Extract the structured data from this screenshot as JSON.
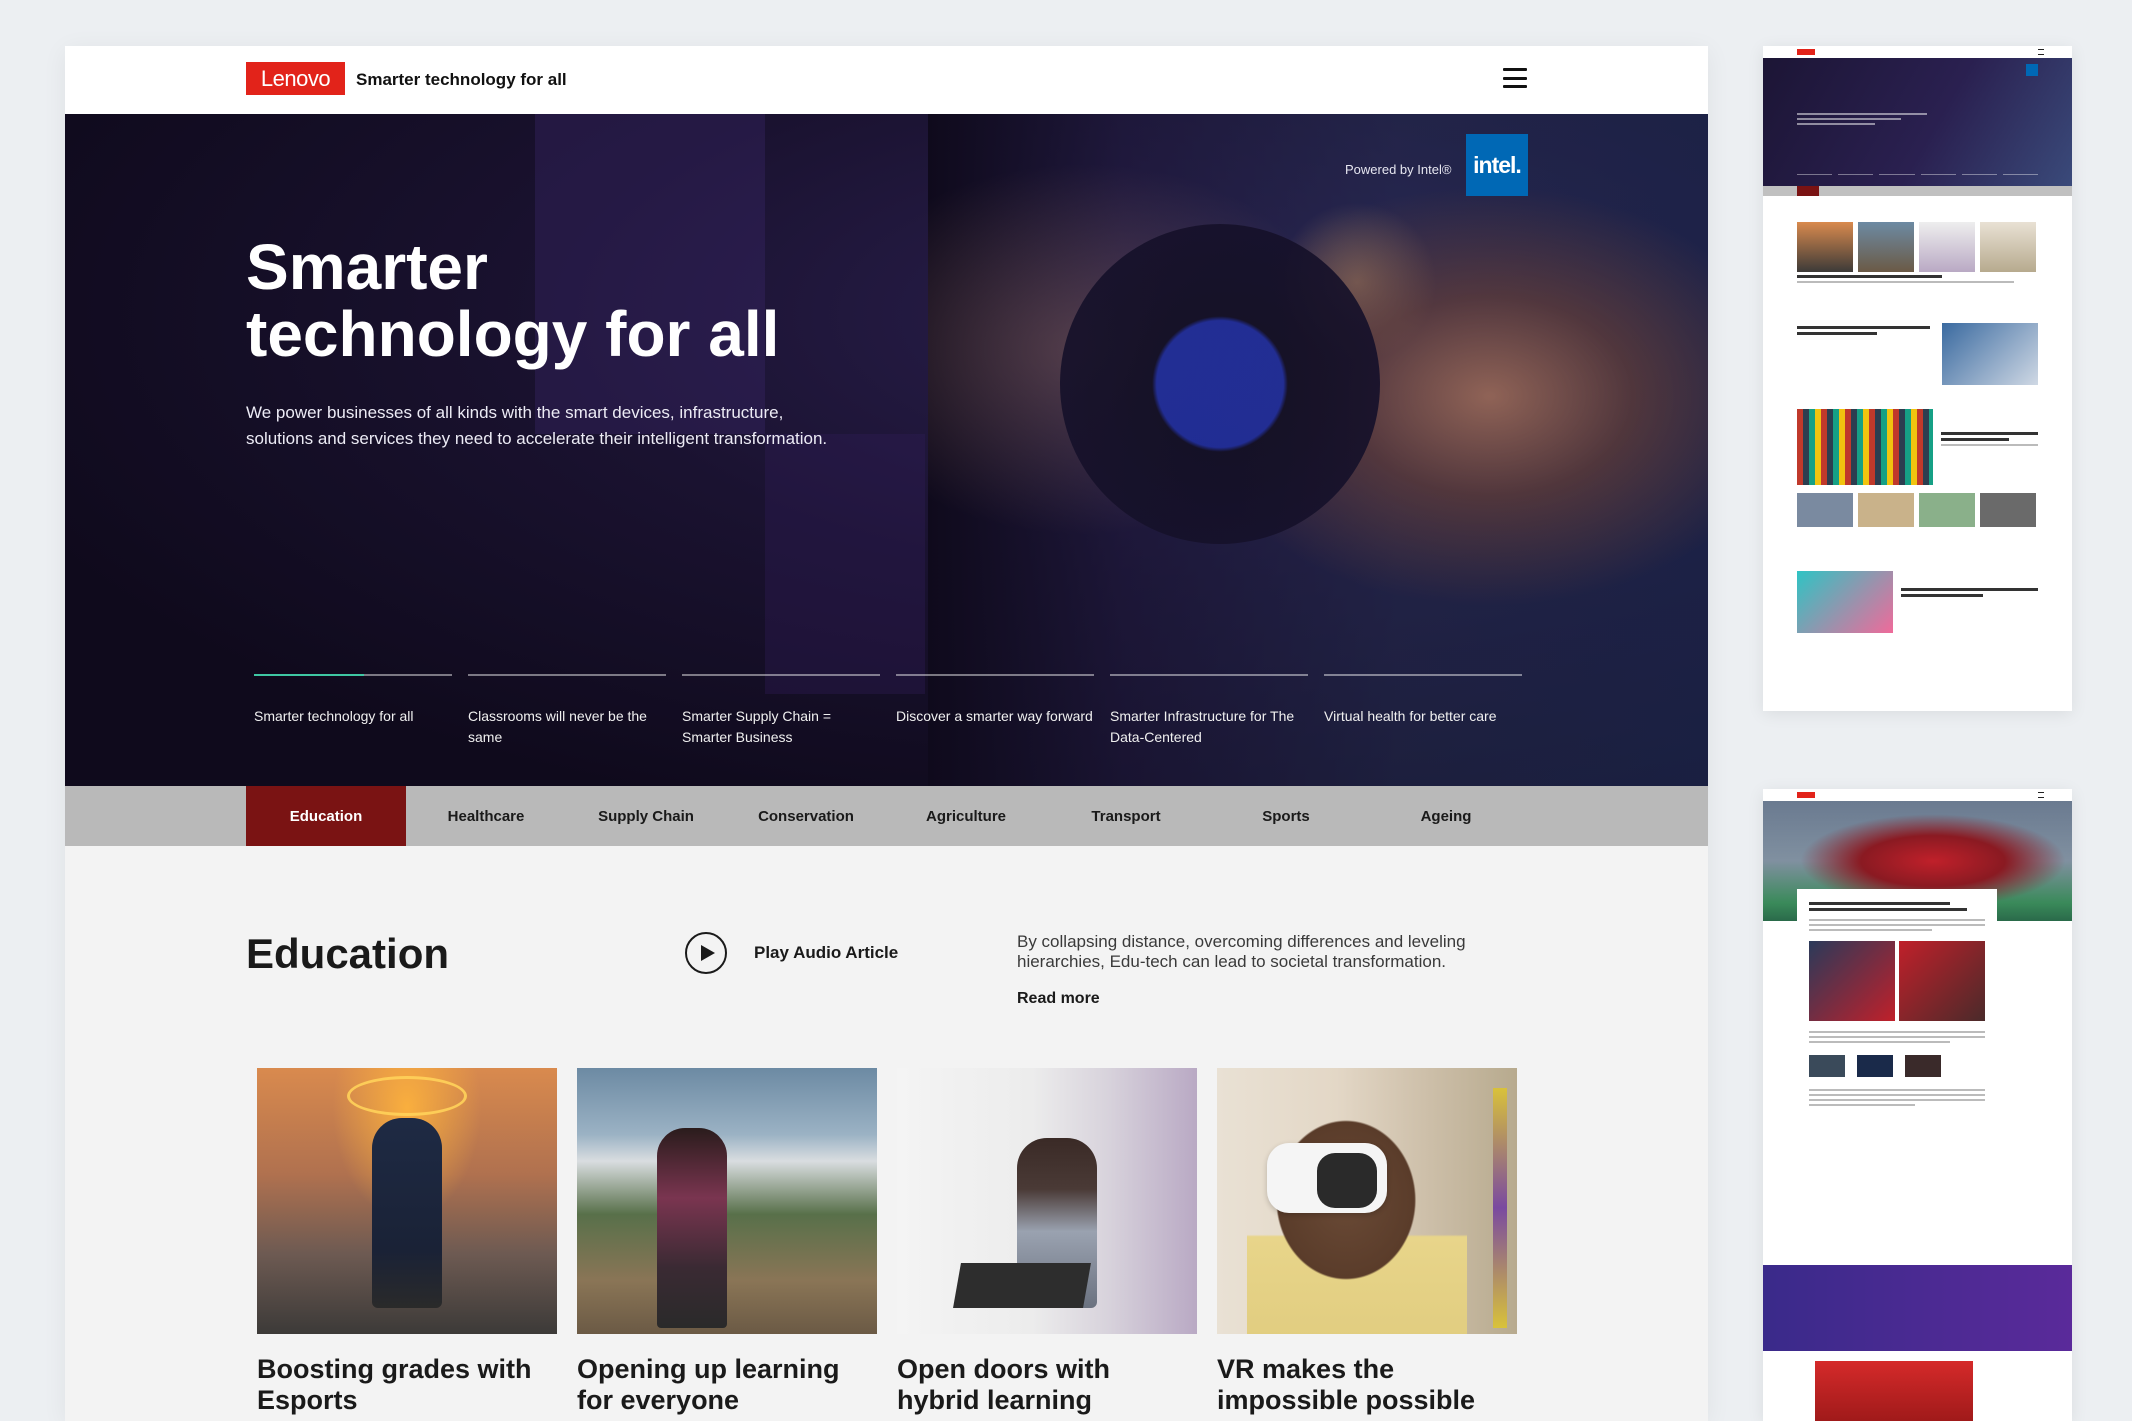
{
  "header": {
    "logo_text": "Lenovo",
    "tagline": "Smarter technology for all",
    "menu_icon": "hamburger-menu-icon"
  },
  "hero": {
    "powered_by": "Powered by Intel®",
    "intel_label": "intel.",
    "title_line1": "Smarter",
    "title_line2": "technology for all",
    "description": "We power businesses of all kinds with the smart devices, infrastructure, solutions and services they need to accelerate their intelligent transformation.",
    "slides": [
      {
        "label": "Smarter technology for all",
        "active": true
      },
      {
        "label": "Classrooms will never be the same",
        "active": false
      },
      {
        "label": "Smarter Supply Chain = Smarter Business",
        "active": false
      },
      {
        "label": "Discover a smarter way forward",
        "active": false
      },
      {
        "label": "Smarter Infrastructure for The Data-Centered",
        "active": false
      },
      {
        "label": "Virtual health for better care",
        "active": false
      }
    ]
  },
  "categories": [
    {
      "label": "Education",
      "active": true
    },
    {
      "label": "Healthcare",
      "active": false
    },
    {
      "label": "Supply Chain",
      "active": false
    },
    {
      "label": "Conservation",
      "active": false
    },
    {
      "label": "Agriculture",
      "active": false
    },
    {
      "label": "Transport",
      "active": false
    },
    {
      "label": "Sports",
      "active": false
    },
    {
      "label": "Ageing",
      "active": false
    }
  ],
  "education": {
    "title": "Education",
    "play_label": "Play Audio Article",
    "description": "By collapsing distance, overcoming differences and leveling hierarchies, Edu-tech can lead to societal transformation.",
    "read_more": "Read more",
    "cards": [
      {
        "title": "Boosting grades with Esports"
      },
      {
        "title": "Opening up learning for everyone"
      },
      {
        "title": "Open doors with hybrid learning"
      },
      {
        "title": "VR makes the impossible possible"
      }
    ]
  },
  "colors": {
    "brand_red": "#e2231a",
    "active_tab": "#7a1313",
    "intel_blue": "#0068b5",
    "slide_progress": "#3fc7a3"
  }
}
